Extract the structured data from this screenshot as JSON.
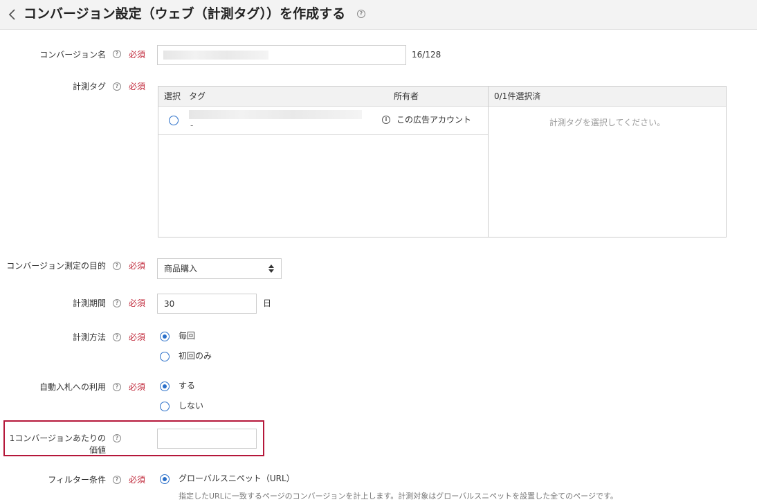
{
  "header": {
    "title": "コンバージョン設定（ウェブ（計測タグ））を作成する",
    "help_glyph": "?"
  },
  "required_text": "必須",
  "help_glyph": "?",
  "conversion_name": {
    "label": "コンバージョン名",
    "char_count": "16/128"
  },
  "measurement_tag": {
    "label": "計測タグ",
    "columns": {
      "select": "選択",
      "tag": "タグ",
      "owner": "所有者"
    },
    "rows": [
      {
        "tag_second_line": "-",
        "owner": "この広告アカウント",
        "info_glyph": "i"
      }
    ],
    "selected_header": "0/1件選択済",
    "selected_placeholder": "計測タグを選択してください。"
  },
  "purpose": {
    "label": "コンバージョン測定の目的",
    "selected": "商品購入"
  },
  "period": {
    "label": "計測期間",
    "value": "30",
    "unit": "日"
  },
  "method": {
    "label": "計測方法",
    "options": [
      {
        "label": "毎回",
        "checked": true
      },
      {
        "label": "初回のみ",
        "checked": false
      }
    ]
  },
  "auto_bid": {
    "label": "自動入札への利用",
    "options": [
      {
        "label": "する",
        "checked": true
      },
      {
        "label": "しない",
        "checked": false
      }
    ]
  },
  "value_per_conversion": {
    "label_line1": "1コンバージョンあたりの",
    "label_line2": "価値",
    "value": ""
  },
  "filter": {
    "label": "フィルター条件",
    "options": [
      {
        "label": "グローバルスニペット（URL）",
        "checked": true
      }
    ],
    "description": "指定したURLに一致するページのコンバージョンを計上します。計測対象はグローバルスニペットを設置した全てのページです。"
  },
  "colors": {
    "accent": "#2a6fc9",
    "required": "#c0283a",
    "highlight_border": "#b5173a",
    "header_bg": "#f3f3f3"
  },
  "icons": [
    "chevron-left-icon",
    "help-icon",
    "info-icon",
    "sort-arrows-icon"
  ]
}
